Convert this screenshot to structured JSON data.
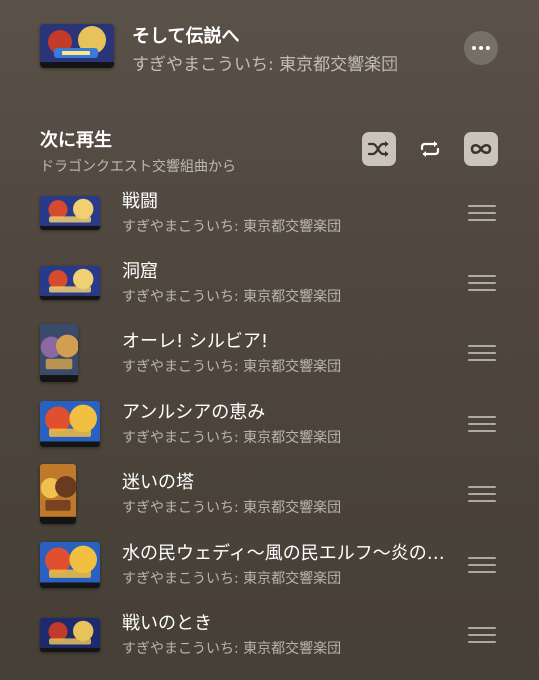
{
  "now_playing": {
    "title": "そして伝説へ",
    "artist": "すぎやまこういち: 東京都交響楽団",
    "art_colors": [
      "#1d2a6e",
      "#c23a2a",
      "#e8c25a",
      "#3a7bd5"
    ],
    "more_icon": "ellipsis-icon"
  },
  "queue": {
    "title": "次に再生",
    "subtitle": "ドラゴンクエスト交響組曲から",
    "controls": [
      {
        "name": "shuffle",
        "icon": "shuffle-icon",
        "active": true
      },
      {
        "name": "repeat",
        "icon": "repeat-icon",
        "active": false
      },
      {
        "name": "autoplay",
        "icon": "infinity-icon",
        "active": true
      }
    ],
    "tracks": [
      {
        "title": "戦闘",
        "artist": "すぎやまこういち: 東京都交響楽団",
        "art": "wide",
        "colors": [
          "#2a3a8a",
          "#d64a2e",
          "#f0d070"
        ]
      },
      {
        "title": "洞窟",
        "artist": "すぎやまこういち: 東京都交響楽団",
        "art": "wide",
        "colors": [
          "#2a3a8a",
          "#d64a2e",
          "#f0d070"
        ]
      },
      {
        "title": "オーレ! シルビア!",
        "artist": "すぎやまこういち: 東京都交響楽団",
        "art": "tall",
        "colors": [
          "#3a4a6a",
          "#8a6aa0",
          "#d0a050"
        ]
      },
      {
        "title": "アンルシアの恵み",
        "artist": "すぎやまこういち: 東京都交響楽団",
        "art": "box",
        "colors": [
          "#2a60c0",
          "#e05030",
          "#f2c040"
        ]
      },
      {
        "title": "迷いの塔",
        "artist": "すぎやまこういち: 東京都交響楽団",
        "art": "tall2",
        "colors": [
          "#c0782a",
          "#f0c050",
          "#6a3a20"
        ]
      },
      {
        "title": "水の民ウェディ〜風の民エルフ〜炎の民オーガ",
        "artist": "すぎやまこういち: 東京都交響楽団",
        "art": "box",
        "colors": [
          "#2a60c0",
          "#e05030",
          "#f2c040"
        ]
      },
      {
        "title": "戦いのとき",
        "artist": "すぎやまこういち: 東京都交響楽団",
        "art": "wide",
        "colors": [
          "#1d2a6e",
          "#c23a2a",
          "#e8c25a"
        ]
      }
    ]
  }
}
